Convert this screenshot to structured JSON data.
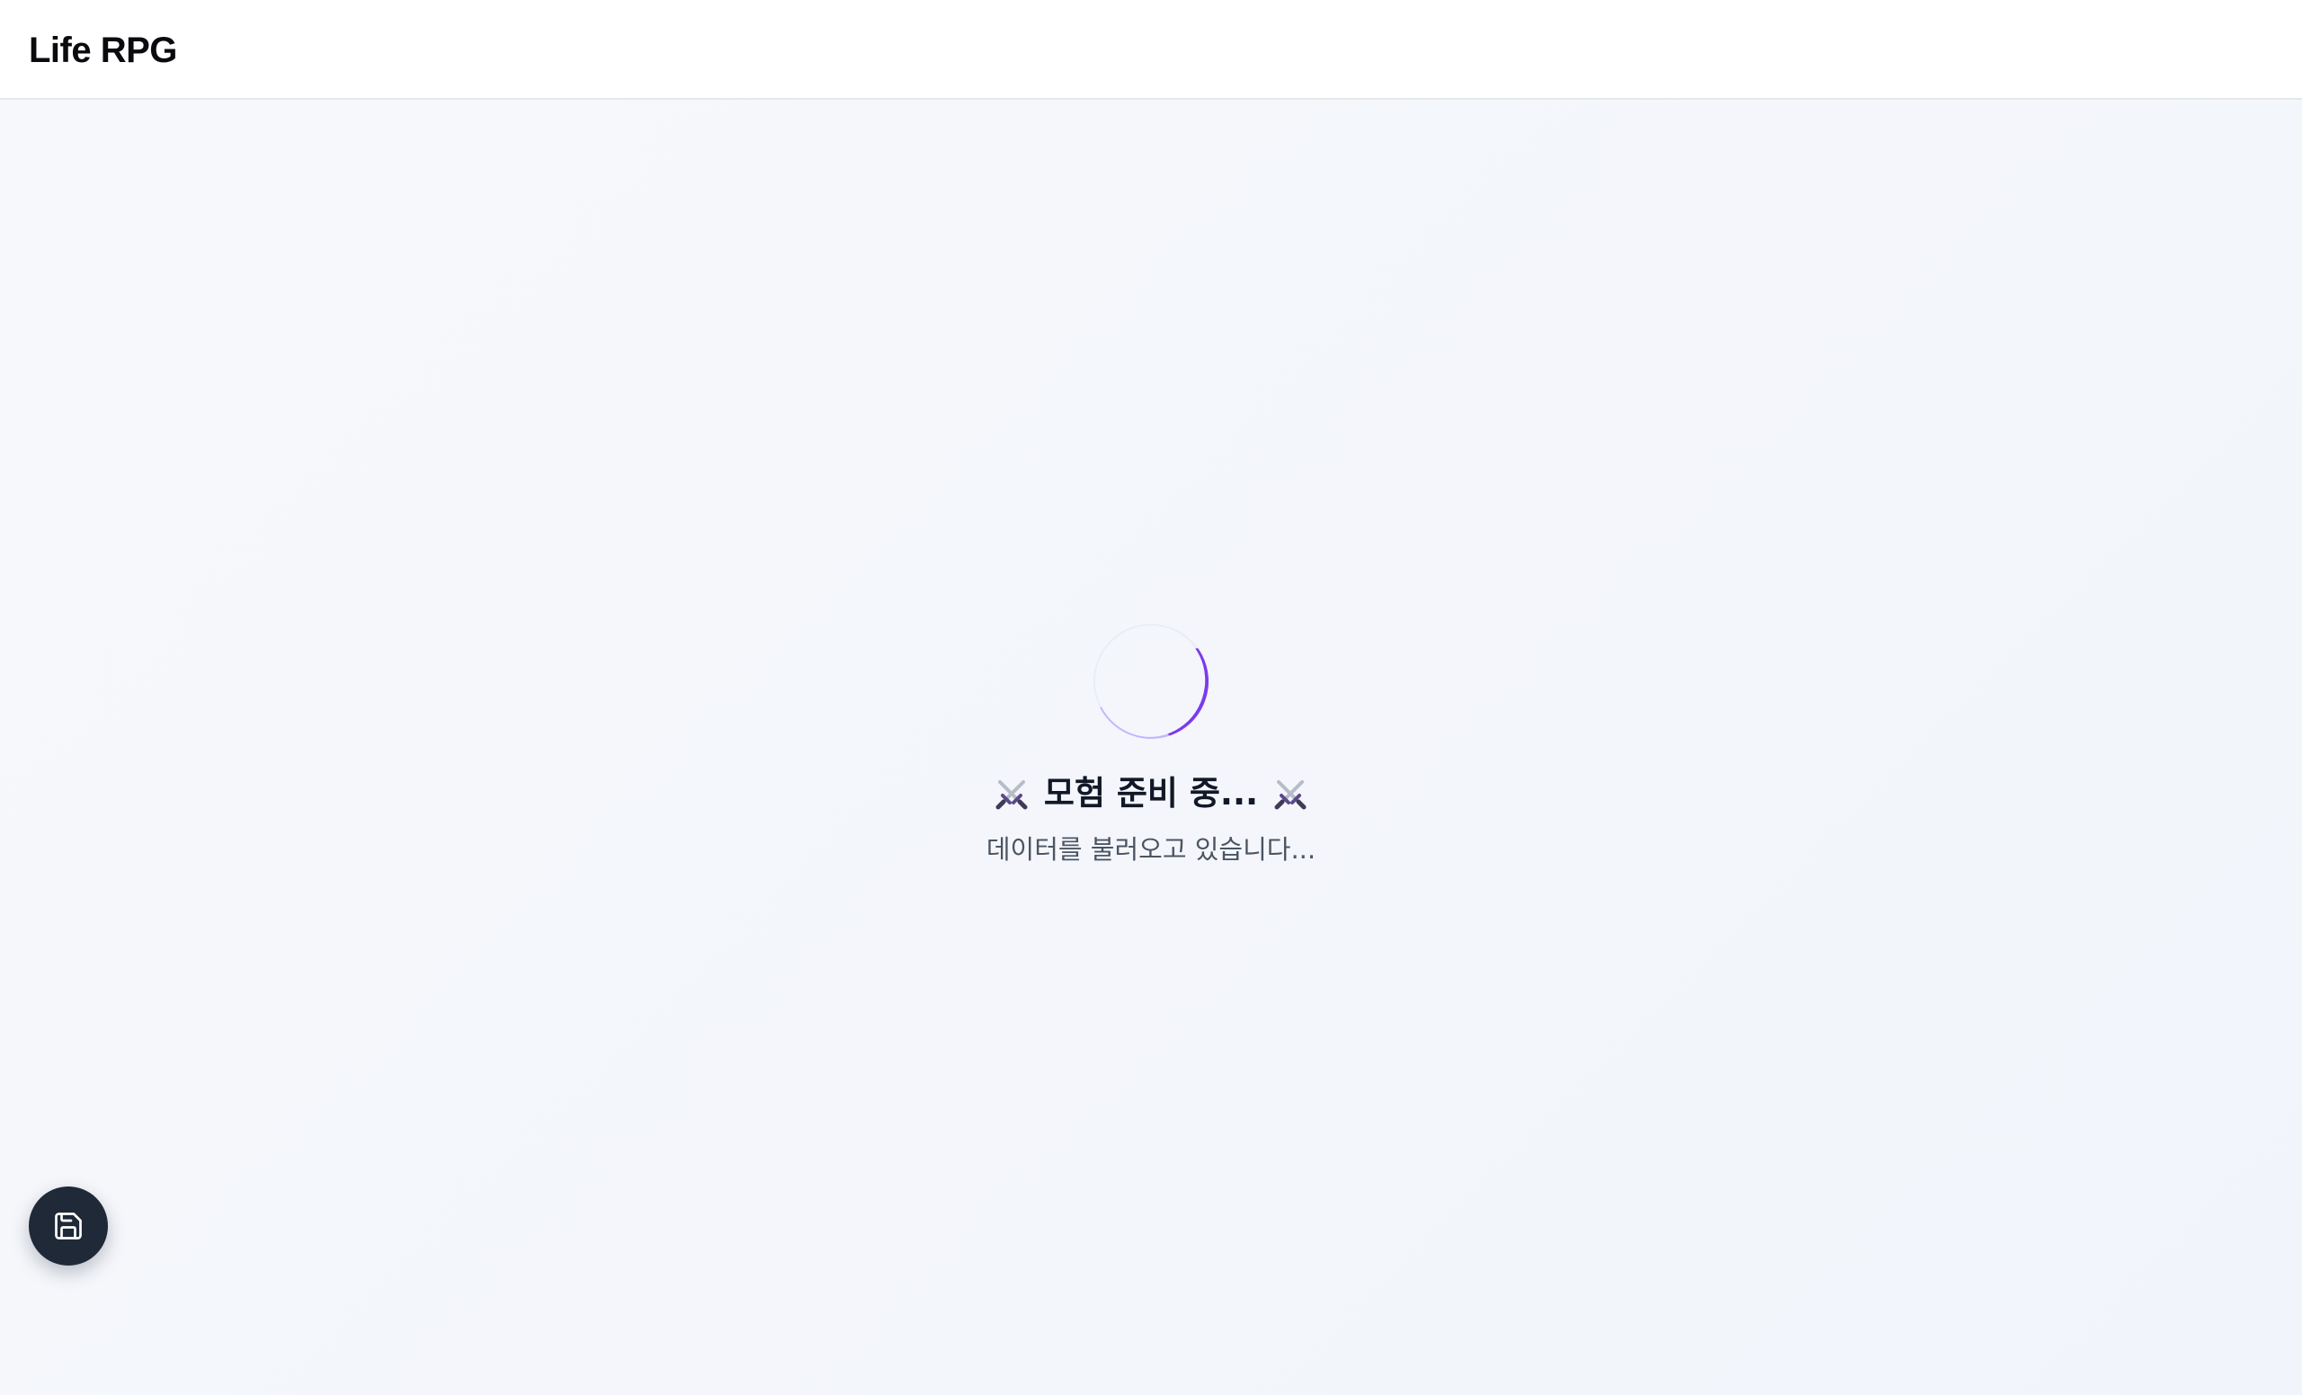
{
  "header": {
    "title": "Life RPG"
  },
  "loading": {
    "title": "모험 준비 중...",
    "subtitle": "데이터를 불러오고 있습니다...",
    "left_icon": "crossed-swords-icon",
    "right_icon": "crossed-swords-icon",
    "spinner_color": "#7c3aed"
  },
  "fab": {
    "icon": "save-icon",
    "background": "#1f2937"
  }
}
